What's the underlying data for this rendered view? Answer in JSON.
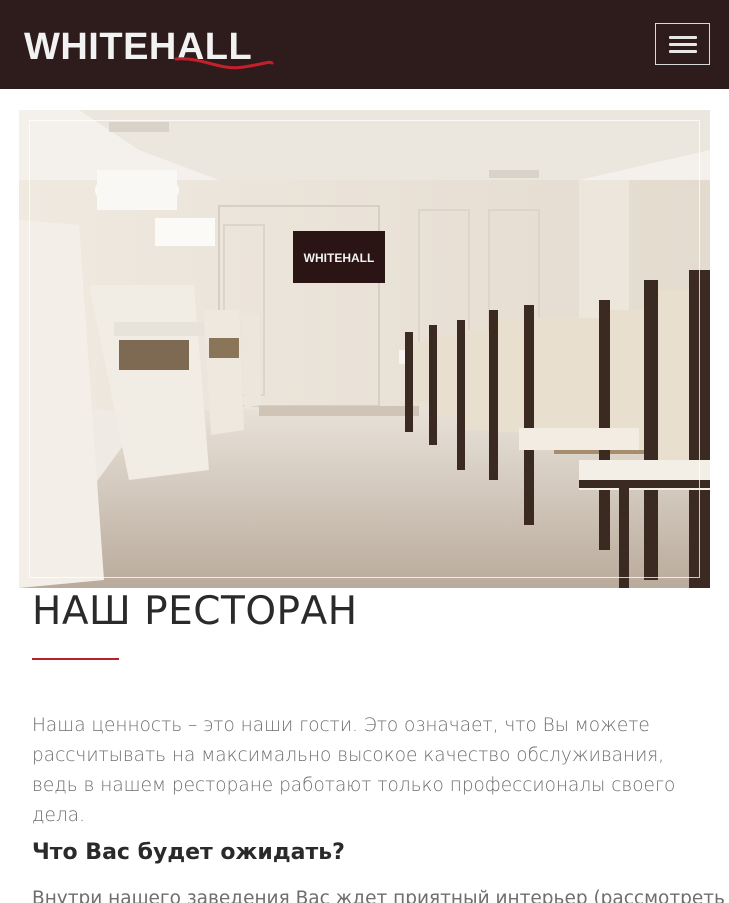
{
  "header": {
    "logo_text": "WHITEHALL",
    "menu_icon": "hamburger-menu-icon",
    "background": "#2e1c1c",
    "accent": "#c2202b"
  },
  "hero": {
    "image_alt": "Интерьер ресторана",
    "tv_logo": "WHITEHALL"
  },
  "section": {
    "title": "НАШ РЕСТОРАН",
    "intro": "Наша ценность – это наши гости. Это означает, что Вы можете рассчитывать на максимально высокое качество обслуживания, ведь в нашем ресторане работают только профессионалы своего дела.",
    "subheading": "Что Вас будет ожидать?",
    "body": "Внутри нашего заведения Вас ждет приятный интерьер (рассмотреть"
  }
}
